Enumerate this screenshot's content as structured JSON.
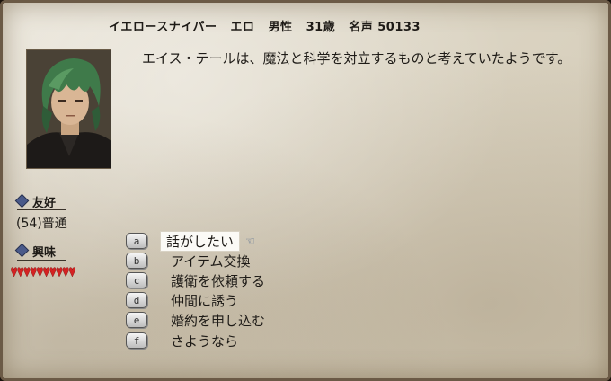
{
  "header": {
    "job": "イエロースナイパー",
    "name": "エロ",
    "gender": "男性",
    "age": "31歳",
    "fame": "名声 50133"
  },
  "dialog": {
    "text": "エイス・テールは、魔法と科学を対立するものと考えていたようです。"
  },
  "stats": {
    "friendship": {
      "label": "友好",
      "value": "(54)普通"
    },
    "interest": {
      "label": "興味",
      "hearts": 10
    }
  },
  "choices": [
    {
      "key": "a",
      "label": "話がしたい",
      "selected": true
    },
    {
      "key": "b",
      "label": "アイテム交換",
      "selected": false
    },
    {
      "key": "c",
      "label": "護衛を依頼する",
      "selected": false
    },
    {
      "key": "d",
      "label": "仲間に誘う",
      "selected": false
    },
    {
      "key": "e",
      "label": "婚約を申し込む",
      "selected": false
    },
    {
      "key": "f",
      "label": "さようなら",
      "selected": false
    }
  ],
  "colors": {
    "heart": "#d42222",
    "diamond": "#4a5a8a"
  }
}
